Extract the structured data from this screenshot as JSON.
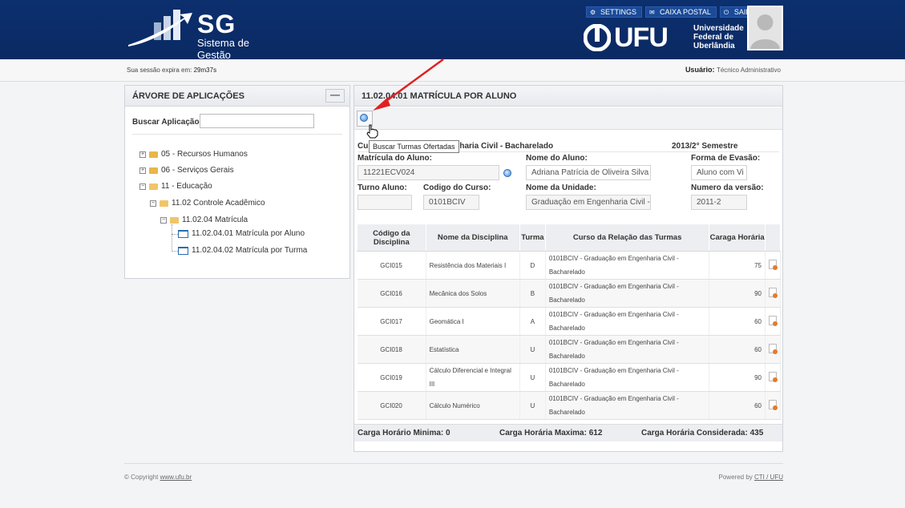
{
  "header": {
    "logo_title": "SG",
    "logo_subtitle": "Sistema de Gestão",
    "nav": [
      {
        "label": "SETTINGS",
        "icon": "gear-icon"
      },
      {
        "label": "CAIXA POSTAL",
        "icon": "mail-icon"
      },
      {
        "label": "SAIR",
        "icon": "power-icon"
      }
    ],
    "ufu_text": "UFU",
    "university_name_line1": "Universidade",
    "university_name_line2": "Federal de",
    "university_name_line3": "Uberlândia"
  },
  "session": {
    "expires_label": "Sua sessão expira em:",
    "expires_value": "29m37s",
    "user_label": "Usuário:",
    "user_value": "Técnico Administrativo"
  },
  "app_tree": {
    "title": "ÁRVORE DE APLICAÇÕES",
    "minimize_label": "—",
    "search_label": "Buscar Aplicação",
    "search_value": "",
    "nodes": [
      {
        "label": "05 - Recursos Humanos",
        "toggle": "+"
      },
      {
        "label": "06 - Serviços Gerais",
        "toggle": "+"
      },
      {
        "label": "11 - Educação",
        "toggle": "−"
      },
      {
        "label": "11.02 Controle Acadêmico",
        "toggle": "−"
      },
      {
        "label": "11.02.04 Matrícula",
        "toggle": "−"
      },
      {
        "label": "11.02.04.01 Matrícula por Aluno"
      },
      {
        "label": "11.02.04.02 Matrícula por Turma"
      }
    ]
  },
  "main": {
    "title": "11.02.04.01 MATRÍCULA POR ALUNO",
    "tooltip": "Buscar Turmas Ofertadas",
    "course_visible": "Cu",
    "course_rest": "haria Civil - Bacharelado",
    "semester": "2013/2° Semestre",
    "fields": {
      "matricula_label": "Matrícula do Aluno:",
      "matricula_value": "11221ECV024",
      "nome_label": "Nome do Aluno:",
      "nome_value": "Adriana Patrícia de Oliveira Silva",
      "evasao_label": "Forma de Evasão:",
      "evasao_value": "Aluno com Vi",
      "turno_label": "Turno Aluno:",
      "turno_value": "",
      "codcurso_label": "Codigo do Curso:",
      "codcurso_value": "0101BCIV",
      "unidade_label": "Nome da Unidade:",
      "unidade_value": "Graduação em Engenharia Civil -",
      "versao_label": "Numero da versão:",
      "versao_value": "2011-2"
    },
    "table": {
      "headers": [
        "Código da Disciplina",
        "Nome da Disciplina",
        "Turma",
        "Curso da Relação das Turmas",
        "Caraga Horária"
      ],
      "rows": [
        {
          "codigo": "GCI015",
          "nome": "Resistência dos Materiais I",
          "turma": "D",
          "curso": "0101BCIV - Graduação em Engenharia Civil - Bacharelado",
          "carga": "75"
        },
        {
          "codigo": "GCI016",
          "nome": "Mecânica dos Solos",
          "turma": "B",
          "curso": "0101BCIV - Graduação em Engenharia Civil - Bacharelado",
          "carga": "90"
        },
        {
          "codigo": "GCI017",
          "nome": "Geomática I",
          "turma": "A",
          "curso": "0101BCIV - Graduação em Engenharia Civil - Bacharelado",
          "carga": "60"
        },
        {
          "codigo": "GCI018",
          "nome": "Estatística",
          "turma": "U",
          "curso": "0101BCIV - Graduação em Engenharia Civil - Bacharelado",
          "carga": "60"
        },
        {
          "codigo": "GCI019",
          "nome": "Cálculo Diferencial e Integral III",
          "turma": "U",
          "curso": "0101BCIV - Graduação em Engenharia Civil - Bacharelado",
          "carga": "90"
        },
        {
          "codigo": "GCI020",
          "nome": "Cálculo Numérico",
          "turma": "U",
          "curso": "0101BCIV - Graduação em Engenharia Civil - Bacharelado",
          "carga": "60"
        }
      ]
    },
    "totals": {
      "min": "Carga Horário Minima: 0",
      "max": "Carga Horária Maxima: 612",
      "considered": "Carga Horária Considerada: 435"
    }
  },
  "footer": {
    "copyright": "© Copyright",
    "copyright_link": "www.ufu.br",
    "powered": "Powered by",
    "powered_link": "CTI / UFU"
  },
  "colors": {
    "header_bg": "#0b2d68",
    "annotation_arrow": "#e02020"
  }
}
